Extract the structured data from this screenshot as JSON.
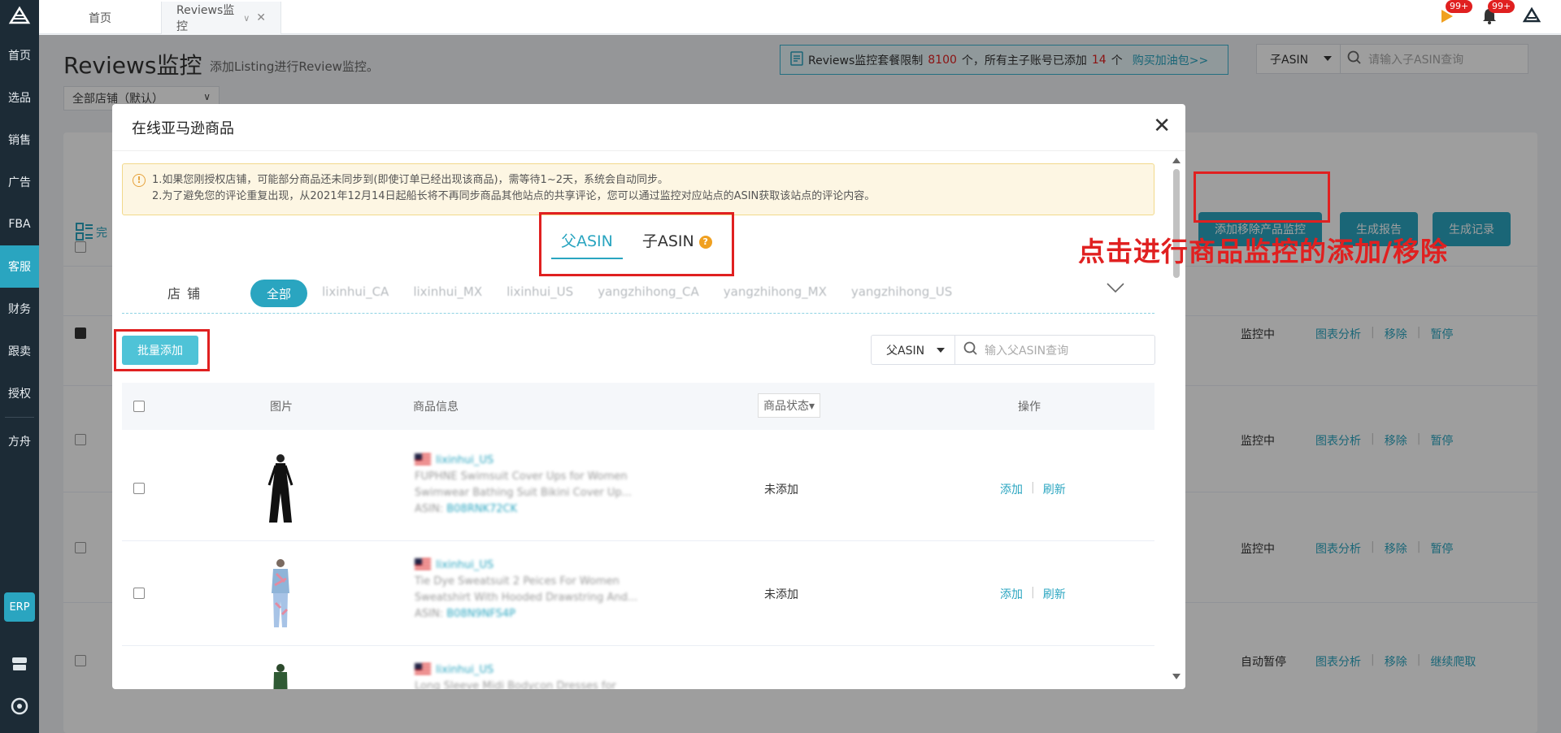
{
  "sidebar": {
    "items": [
      {
        "label": "首页"
      },
      {
        "label": "选品"
      },
      {
        "label": "销售"
      },
      {
        "label": "广告"
      },
      {
        "label": "FBA"
      },
      {
        "label": "客服"
      },
      {
        "label": "财务"
      },
      {
        "label": "跟卖"
      },
      {
        "label": "授权"
      },
      {
        "label": "方舟"
      }
    ],
    "active": "客服",
    "erp_label": "ERP"
  },
  "topbar": {
    "tabs": [
      {
        "label": "首页"
      },
      {
        "label": "Reviews监控"
      }
    ],
    "badge_flag": "99+",
    "badge_bell": "99+"
  },
  "page": {
    "title": "Reviews监控",
    "subtitle": "添加Listing进行Review监控。",
    "store_select": "全部店铺（默认）",
    "limit": {
      "prefix": "Reviews监控套餐限制",
      "limit_value": "8100",
      "middle": "个，所有主子账号已添加",
      "added_value": "14",
      "suffix": "个",
      "link": "购买加油包>>"
    },
    "search": {
      "type": "子ASIN",
      "placeholder": "请输入子ASIN查询"
    },
    "list_label": "完",
    "buttons": {
      "add_remove": "添加移除产品监控",
      "report": "生成报告",
      "record": "生成记录"
    },
    "rows": [
      {
        "status": "监控中",
        "a1": "图表分析",
        "a2": "移除",
        "a3": "暂停",
        "checked": true
      },
      {
        "status": "监控中",
        "a1": "图表分析",
        "a2": "移除",
        "a3": "暂停",
        "checked": false
      },
      {
        "status": "监控中",
        "a1": "图表分析",
        "a2": "移除",
        "a3": "暂停",
        "checked": false
      },
      {
        "status": "自动暂停",
        "a1": "图表分析",
        "a2": "移除",
        "a3": "继续爬取",
        "checked": false
      }
    ]
  },
  "modal": {
    "title": "在线亚马逊商品",
    "notice_line1": "1.如果您刚授权店铺，可能部分商品还未同步到(即使订单已经出现该商品)，需等待1~2天，系统会自动同步。",
    "notice_line2": "2.为了避免您的评论重复出现，从2021年12月14日起船长将不再同步商品其他站点的共享评论，您可以通过监控对应站点的ASIN获取该站点的评论内容。",
    "asin_tabs": [
      "父ASIN",
      "子ASIN"
    ],
    "store_label": "店铺",
    "store_all": "全部",
    "stores": [
      "lixinhui_CA",
      "lixinhui_MX",
      "lixinhui_US",
      "yangzhihong_CA",
      "yangzhihong_MX",
      "yangzhihong_US"
    ],
    "batch_add": "批量添加",
    "search": {
      "type": "父ASIN",
      "placeholder": "输入父ASIN查询"
    },
    "columns": {
      "image": "图片",
      "info": "商品信息",
      "status": "商品状态",
      "ops": "操作"
    },
    "products": [
      {
        "store": "lixinhui_US",
        "title1": "FUPHNE Swimsuit Cover Ups for Women",
        "title2": "Swimwear Bathing Suit Bikini Cover Up...",
        "asin_label": "ASIN:",
        "asin": "B08RNK72CK",
        "status": "未添加",
        "add": "添加",
        "refresh": "刷新"
      },
      {
        "store": "lixinhui_US",
        "title1": "Tie Dye Sweatsuit 2 Peices For Women",
        "title2": "Sweatshirt With Hooded Drawstring And...",
        "asin_label": "ASIN:",
        "asin": "B08N9NFS4P",
        "status": "未添加",
        "add": "添加",
        "refresh": "刷新"
      },
      {
        "store": "lixinhui_US",
        "title1": "Long Sleeve Midi Bodycon Dresses for",
        "title2": "",
        "asin_label": "",
        "asin": "",
        "status": "",
        "add": "",
        "refresh": ""
      }
    ]
  },
  "annotation": "点击进行商品监控的添加/移除",
  "colors": {
    "accent": "#2aa5c0",
    "sidebar": "#1c2b36",
    "annotation": "#e02020"
  }
}
